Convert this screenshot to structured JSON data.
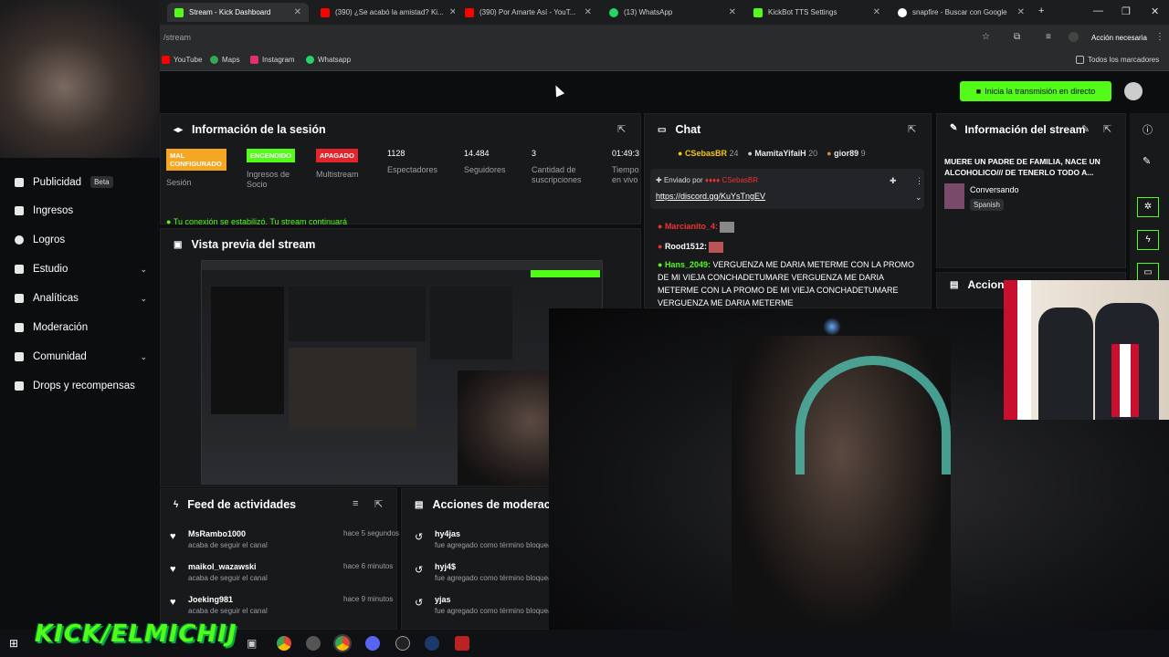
{
  "browser": {
    "tabs": [
      {
        "label": "Stream - Kick Dashboard",
        "color": "#53fc18"
      },
      {
        "label": "(390) ¿Se acabó la amistad? Ki...",
        "color": "#ff0000"
      },
      {
        "label": "(390) Por Amarte Así - YouT...",
        "color": "#ff0000"
      },
      {
        "label": "(13) WhatsApp",
        "color": "#25d366"
      },
      {
        "label": "KickBot TTS Settings",
        "color": "#53fc18"
      },
      {
        "label": "snapfire - Buscar con Google",
        "color": "#4285f4"
      }
    ],
    "url": "/stream",
    "action_needed": "Acción necesaria",
    "bookmarks": [
      "YouTube",
      "Maps",
      "Instagram",
      "Whatsapp"
    ],
    "all_bookmarks": "Todos los marcadores"
  },
  "sidebar": {
    "items": [
      {
        "label": "Publicidad",
        "badge": "Beta"
      },
      {
        "label": "Ingresos"
      },
      {
        "label": "Logros"
      },
      {
        "label": "Estudio",
        "chevron": "⌄"
      },
      {
        "label": "Analíticas",
        "chevron": "⌄"
      },
      {
        "label": "Moderación"
      },
      {
        "label": "Comunidad",
        "chevron": "⌄"
      },
      {
        "label": "Drops y recompensas"
      }
    ]
  },
  "header": {
    "go_live": "Inicia la transmisión en directo"
  },
  "session": {
    "title": "Información de la sesión",
    "stats": [
      {
        "value": "MAL CONFIGURADO",
        "label": "Sesión"
      },
      {
        "value": "ENCENDIDO",
        "label": "Ingresos de Socio"
      },
      {
        "value": "APAGADO",
        "label": "Multistream"
      },
      {
        "value": "1128",
        "label": "Espectadores"
      },
      {
        "value": "14.484",
        "label": "Seguidores"
      },
      {
        "value": "3",
        "label": "Cantidad de suscripciones"
      },
      {
        "value": "01:49:3",
        "label": "Tiempo en vivo"
      }
    ],
    "status": "Tu conexión se estabilizó. Tu stream continuará"
  },
  "preview": {
    "title": "Vista previa del stream"
  },
  "chat": {
    "title": "Chat",
    "top_gifters": [
      {
        "name": "CSebasBR",
        "count": "24"
      },
      {
        "name": "MamitaYifaiH",
        "count": "20"
      },
      {
        "name": "gior89",
        "count": "9"
      }
    ],
    "pinned_by": "Enviado por",
    "pinned_user": "CSebasBR",
    "pinned_link": "https://discord.gg/KuYsTngEV",
    "messages": [
      {
        "user": "Marcianito_4:",
        "text": "",
        "color": "#e33"
      },
      {
        "user": "Rood1512:",
        "text": "",
        "color": "#fff"
      },
      {
        "user": "Hans_2049:",
        "text": "VERGUENZA ME DARIA METERME CON LA PROMO DE MI VIEJA CONCHADETUMARE VERGUENZA ME DARIA METERME CON LA PROMO DE MI VIEJA CONCHADETUMARE VERGUENZA ME DARIA METERME",
        "color": "#53fc18"
      }
    ]
  },
  "stream_info": {
    "title": "Información del stream",
    "stream_title": "MUERE UN PADRE DE FAMILIA, NACE UN ALCOHOLICO/// DE TENERLO TODO A...",
    "category": "Conversando",
    "language": "Spanish"
  },
  "mod_actions_right": {
    "title": "Acciones de moderación"
  },
  "feed": {
    "title": "Feed de actividades",
    "items": [
      {
        "user": "MsRambo1000",
        "action": "acaba de seguir el canal",
        "time": "hace 5 segundos"
      },
      {
        "user": "maikol_wazawski",
        "action": "acaba de seguir el canal",
        "time": "hace 6 minutos"
      },
      {
        "user": "Joeking981",
        "action": "acaba de seguir el canal",
        "time": "hace 9 minutos"
      }
    ]
  },
  "mod_actions": {
    "title": "Acciones de moderación",
    "items": [
      {
        "term": "hy4jas",
        "desc": "fue agregado como término bloqueado"
      },
      {
        "term": "hyj4$",
        "desc": "fue agregado como término bloqueado"
      },
      {
        "term": "yjas",
        "desc": "fue agregado como término bloqueado"
      }
    ]
  },
  "overlay": {
    "channel": "KICK/ELMICHIJ"
  }
}
